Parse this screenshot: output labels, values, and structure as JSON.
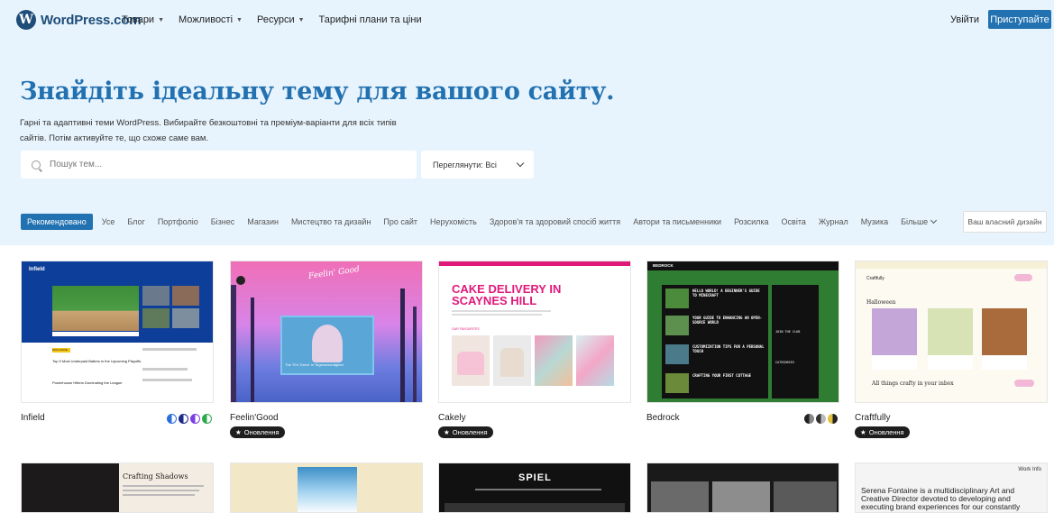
{
  "brand": {
    "name": "WordPress.com"
  },
  "nav": {
    "items": [
      {
        "label": "Товари",
        "dropdown": true
      },
      {
        "label": "Можливості",
        "dropdown": true
      },
      {
        "label": "Ресурси",
        "dropdown": true
      },
      {
        "label": "Тарифні плани та ціни",
        "dropdown": false
      }
    ],
    "login": "Увійти",
    "start": "Приступайте"
  },
  "hero": {
    "title": "Знайдіть ідеальну тему для вашого сайту.",
    "subtitle": "Гарні та адаптивні теми WordPress. Вибирайте безкоштовні та преміум-варіанти для всіх типів сайтів. Потім активуйте те, що схоже саме вам."
  },
  "search": {
    "placeholder": "Пошук тем..."
  },
  "view_select": {
    "label": "Переглянути: Всі"
  },
  "tabs": [
    "Рекомендовано",
    "Усе",
    "Блог",
    "Портфоліо",
    "Бізнес",
    "Магазин",
    "Мистецтво та дизайн",
    "Про сайт",
    "Нерухомість",
    "Здоров'я та здоровий спосіб життя",
    "Автори та письменники",
    "Розсилка",
    "Освіта",
    "Журнал",
    "Музика",
    "Більше"
  ],
  "own_design": "Ваш власний дизайн",
  "themes": [
    {
      "name": "Infield",
      "badge": "",
      "styles": [
        "#2a6fdb",
        "#1b2a8a",
        "#7b3fe4",
        "#2ea84d"
      ]
    },
    {
      "name": "Feelin'Good",
      "badge": "Оновлення",
      "styles": []
    },
    {
      "name": "Cakely",
      "badge": "Оновлення",
      "styles": []
    },
    {
      "name": "Bedrock",
      "badge": "",
      "styles": [
        "#222222",
        "#555555",
        "#e3c23d"
      ]
    },
    {
      "name": "Craftfully",
      "badge": "Оновлення",
      "styles": []
    }
  ],
  "previews": {
    "infield": {
      "brand": "Infield",
      "headline1": "Top 5 Most Underpaid Batters in the Upcoming Playoffs",
      "headline2": "Powerhouse Hitters Dominating the League",
      "label": "EXCLUSIVE"
    },
    "feelin": {
      "script": "Feelin' Good",
      "caption": "The 70's Trend: In Tegenwoordighed"
    },
    "cakely": {
      "headline": "CAKE DELIVERY IN SCAYNES HILL",
      "section": "OUR FAVOURITES"
    },
    "bedrock": {
      "brand": "BEDROCK",
      "post1": "HELLO WORLD! A BEGINNER'S GUIDE TO MINECRAFT",
      "post2": "YOUR GUIDE TO ENHANCING AN OPEN-SOURCE WORLD",
      "post3": "CUSTOMIZATION TIPS FOR A PERSONAL TOUCH",
      "post4": "CRAFTING YOUR FIRST COTTAGE",
      "side1": "JOIN THE CLUB",
      "side2": "CATEGORIES"
    },
    "craftfully": {
      "brand": "Craftfully",
      "heading": "Halloween",
      "footer": "All things crafty in your inbox"
    },
    "crafting": {
      "title": "Crafting Shadows"
    },
    "spiel": {
      "brand": "SPIEL"
    },
    "serena": {
      "nav": "Work  Info",
      "text": "Serena Fontaine is a multidisciplinary Art and Creative Director devoted to developing and executing brand experiences for our constantly changing world"
    }
  }
}
